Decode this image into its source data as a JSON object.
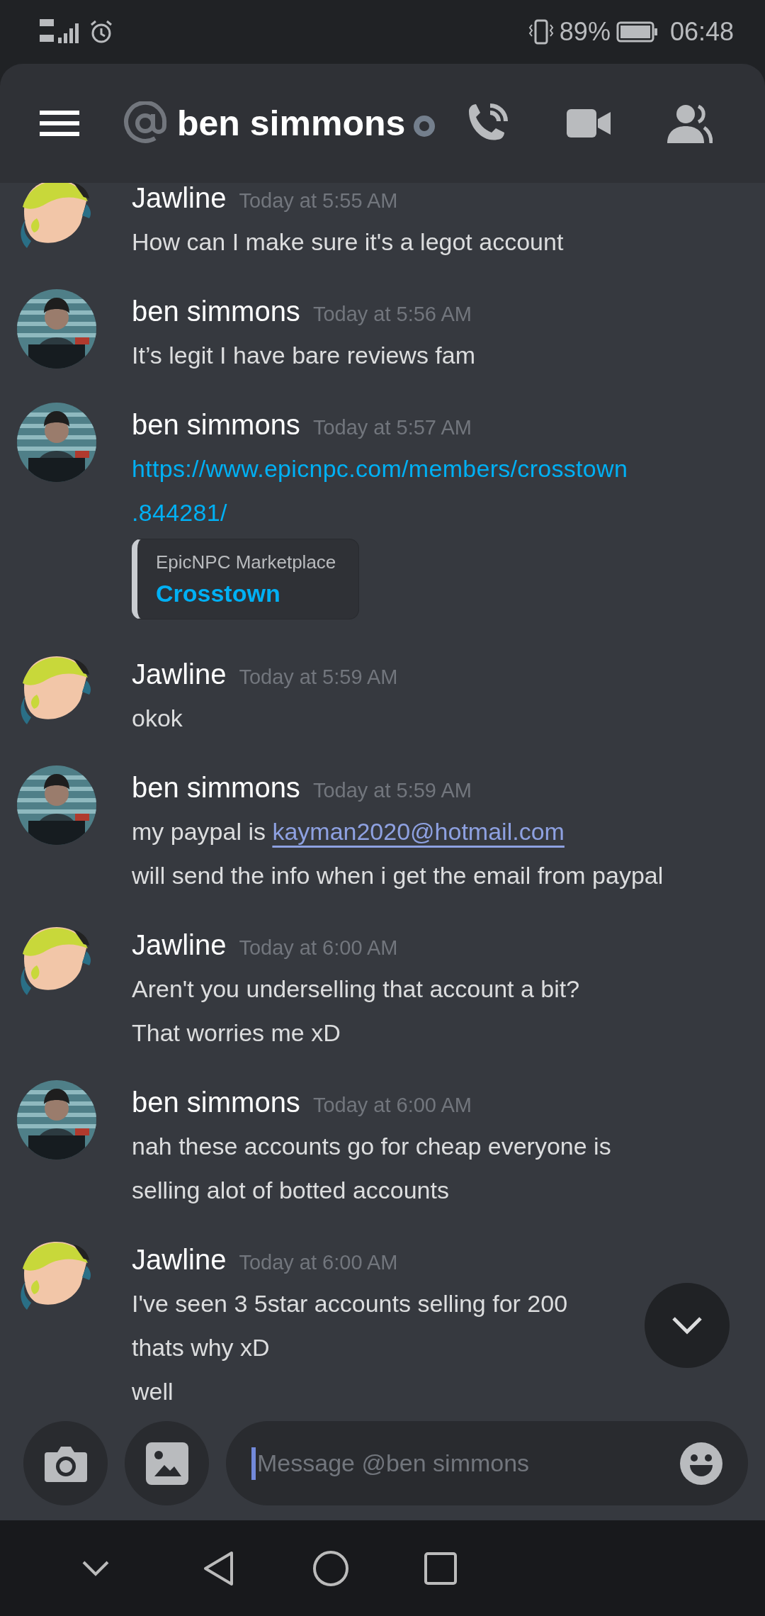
{
  "status_bar": {
    "battery": "89%",
    "time": "06:48"
  },
  "header": {
    "title": "ben simmons",
    "online": false
  },
  "messages": [
    {
      "author": "Jawline",
      "avatar": {
        "kind": "drawing"
      },
      "time": "Today at 5:55 AM",
      "lines": [
        {
          "kind": "text",
          "text": "How can I make sure it's a legot account"
        }
      ]
    },
    {
      "author": "ben simmons",
      "avatar": {
        "kind": "photo"
      },
      "time": "Today at 5:56 AM",
      "lines": [
        {
          "kind": "text",
          "text": "It’s legit I have bare reviews fam"
        }
      ]
    },
    {
      "author": "ben simmons",
      "avatar": {
        "kind": "photo"
      },
      "time": "Today at 5:57 AM",
      "lines": [
        {
          "kind": "url",
          "text": "https://www.epicnpc.com/members/crosstown"
        },
        {
          "kind": "url",
          "text": ".844281/"
        }
      ],
      "embed": {
        "provider": "EpicNPC Marketplace",
        "title": "Crosstown"
      }
    },
    {
      "author": "Jawline",
      "avatar": {
        "kind": "drawing"
      },
      "time": "Today at 5:59 AM",
      "lines": [
        {
          "kind": "text",
          "text": "okok"
        }
      ]
    },
    {
      "author": "ben simmons",
      "avatar": {
        "kind": "photo"
      },
      "time": "Today at 5:59 AM",
      "lines": [
        {
          "kind": "email",
          "text": "my paypal is",
          "email": "kayman2020@hotmail.com"
        },
        {
          "kind": "text",
          "text": "will send the info when i get the email from paypal"
        }
      ]
    },
    {
      "author": "Jawline",
      "avatar": {
        "kind": "drawing"
      },
      "time": "Today at 6:00 AM",
      "lines": [
        {
          "kind": "text",
          "text": "Aren't you underselling that account a bit?"
        },
        {
          "kind": "text",
          "text": "That worries me xD"
        }
      ]
    },
    {
      "author": "ben simmons",
      "avatar": {
        "kind": "photo"
      },
      "time": "Today at 6:00 AM",
      "lines": [
        {
          "kind": "text",
          "text": "nah these accounts go for cheap everyone is"
        },
        {
          "kind": "text",
          "text": "selling alot of botted accounts"
        }
      ]
    },
    {
      "author": "Jawline",
      "avatar": {
        "kind": "drawing"
      },
      "time": "Today at 6:00 AM",
      "lines": [
        {
          "kind": "text",
          "text": "I've seen 3 5star accounts selling for 200"
        },
        {
          "kind": "text",
          "text": "thats why xD"
        },
        {
          "kind": "text",
          "text": "well"
        }
      ]
    }
  ],
  "composer": {
    "placeholder": "Message @ben simmons"
  }
}
